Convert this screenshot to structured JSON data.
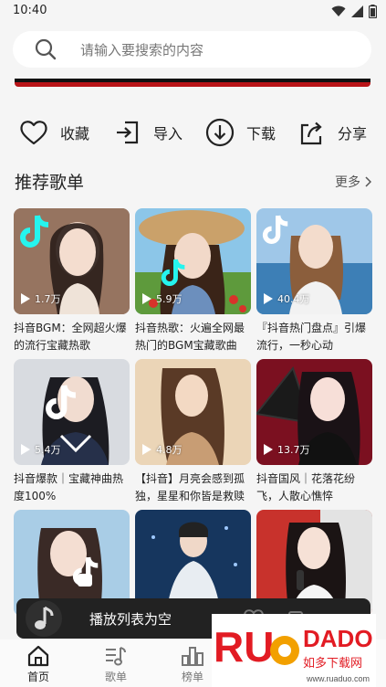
{
  "status_bar": {
    "time": "10:40"
  },
  "search": {
    "placeholder": "请输入要搜索的内容"
  },
  "actions": [
    {
      "label": "收藏",
      "icon": "heart-icon"
    },
    {
      "label": "导入",
      "icon": "import-icon"
    },
    {
      "label": "下载",
      "icon": "download-icon"
    },
    {
      "label": "分享",
      "icon": "share-icon"
    }
  ],
  "section": {
    "title": "推荐歌单",
    "more": "更多"
  },
  "playlists": [
    {
      "title": "抖音BGM：全网超火爆的流行宝藏热歌",
      "plays": "1.7万"
    },
    {
      "title": "抖音热歌：火遍全网最热门的BGM宝藏歌曲",
      "plays": "5.9万"
    },
    {
      "title": "『抖音热门盘点』引爆流行，一秒心动",
      "plays": "40.4万"
    },
    {
      "title": "抖音爆款｜宝藏神曲热度100%",
      "plays": "5.4万"
    },
    {
      "title": "【抖音】月亮会感到孤独，星星和你皆是救赎",
      "plays": "4.8万"
    },
    {
      "title": "抖音国风｜花落花纷飞，人散心憔悴",
      "plays": "13.7万"
    },
    {
      "title": "",
      "plays": ""
    },
    {
      "title": "",
      "plays": ""
    },
    {
      "title": "",
      "plays": ""
    }
  ],
  "player": {
    "text": "播放列表为空"
  },
  "nav": [
    {
      "label": "首页",
      "icon": "home-icon",
      "active": true
    },
    {
      "label": "歌单",
      "icon": "playlist-icon",
      "active": false
    },
    {
      "label": "榜单",
      "icon": "chart-icon",
      "active": false
    }
  ],
  "watermark": {
    "brand": "RUANDADO",
    "subtitle": "如多下载网",
    "url": "www.ruaduo.com"
  },
  "colors": {
    "accent": "#b81418",
    "background": "#f5f5f5",
    "player": "#222222"
  }
}
